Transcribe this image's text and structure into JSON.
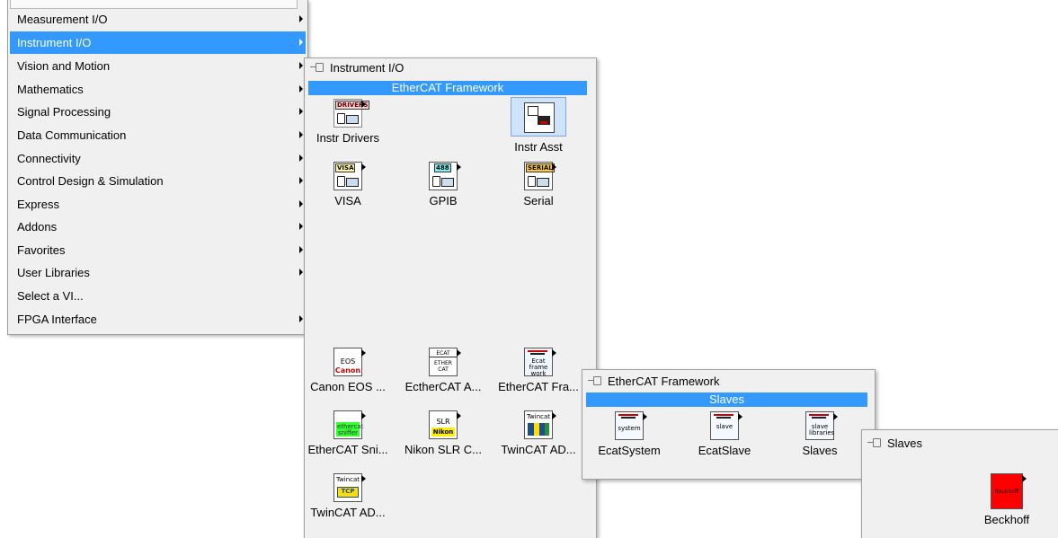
{
  "menu": {
    "items": [
      "Measurement I/O",
      "Instrument I/O",
      "Vision and Motion",
      "Mathematics",
      "Signal Processing",
      "Data Communication",
      "Connectivity",
      "Control Design & Simulation",
      "Express",
      "Addons",
      "Favorites",
      "User Libraries",
      "Select a VI...",
      "FPGA Interface"
    ],
    "selected": "Instrument I/O"
  },
  "instrument_palette": {
    "title": "Instrument I/O",
    "subpalette": "EtherCAT Framework",
    "items": [
      {
        "label": "Instr Drivers",
        "icon": "instr-drivers-icon",
        "tag": "DRIVERS"
      },
      {
        "label": "Instr Asst",
        "icon": "instr-asst-icon"
      },
      {
        "label": "VISA",
        "icon": "visa-icon",
        "tag": "VISA"
      },
      {
        "label": "GPIB",
        "icon": "gpib-icon",
        "tag": "488"
      },
      {
        "label": "Serial",
        "icon": "serial-icon",
        "tag": "SERIAL"
      },
      {
        "label": "Canon EOS ...",
        "icon": "canon-eos-icon",
        "line1": "EOS",
        "line2": "Canon"
      },
      {
        "label": "EctherCAT A...",
        "icon": "ethercat-a-icon",
        "line1": "ECAT",
        "line2": "ETHER CAT"
      },
      {
        "label": "EtherCAT Fra...",
        "icon": "ethercat-framework-icon",
        "line1": "Ecat frame work"
      },
      {
        "label": "EtherCAT Sni...",
        "icon": "ethercat-sniffer-icon",
        "line1": "ethercat sniffer"
      },
      {
        "label": "Nikon SLR C...",
        "icon": "nikon-slr-icon",
        "line1": "SLR",
        "line2": "Nikon"
      },
      {
        "label": "TwinCAT AD...",
        "icon": "twincat-ads-icon",
        "line1": "Twincat"
      },
      {
        "label": "TwinCAT AD...",
        "icon": "twincat-ads-tcp-icon",
        "line1": "Twincat",
        "line2": "TCP"
      }
    ]
  },
  "ethercat_palette": {
    "title": "EtherCAT Framework",
    "subpalette": "Slaves",
    "items": [
      {
        "label": "EcatSystem",
        "icon": "ecat-system-icon",
        "line1": "system"
      },
      {
        "label": "EcatSlave",
        "icon": "ecat-slave-icon",
        "line1": "slave"
      },
      {
        "label": "Slaves",
        "icon": "slaves-icon",
        "line1": "slave libraries"
      }
    ]
  },
  "slaves_palette": {
    "title": "Slaves",
    "items": [
      {
        "label": "Beckhoff",
        "icon": "beckhoff-icon",
        "line1": "Beckhoff"
      }
    ]
  },
  "colors": {
    "selection": "#3399ff",
    "panel": "#f0f0f0",
    "beckhoff_red": "#ff0000",
    "sniffer_green": "#33ff33",
    "nikon_yellow": "#ffee00"
  }
}
